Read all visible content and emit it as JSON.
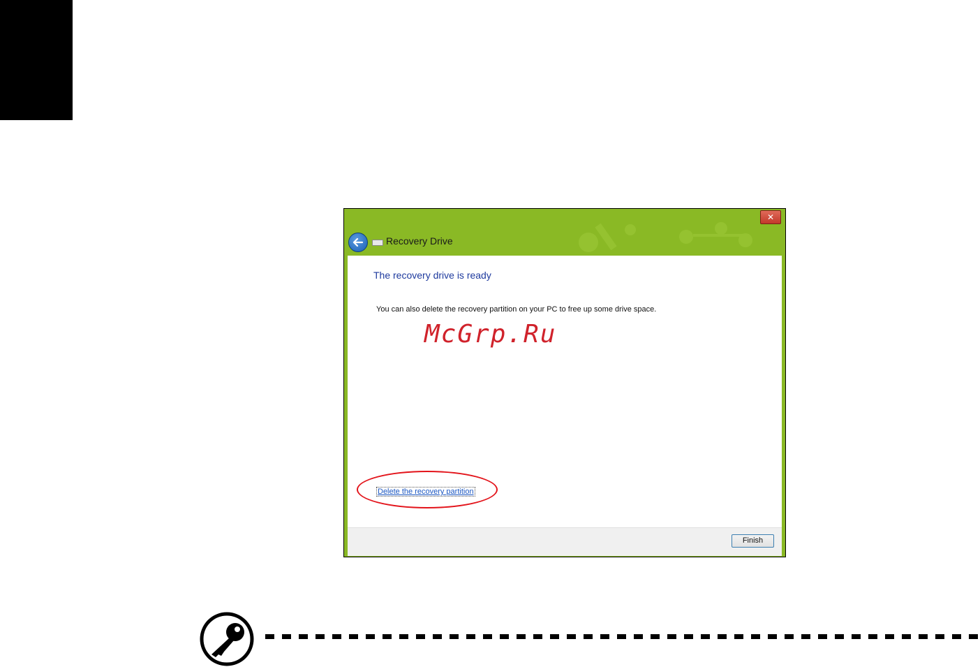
{
  "window": {
    "title": "Recovery Drive",
    "close_label": "✕",
    "heading": "The recovery drive is ready",
    "body_text": "You can also delete the recovery partition on your PC to free up some drive space.",
    "delete_link": "Delete the recovery partition",
    "finish_button": "Finish"
  },
  "watermark": "McGrp.Ru",
  "icons": {
    "back": "back-arrow-icon",
    "drive": "drive-icon",
    "close": "close-icon",
    "note": "key-icon"
  },
  "colors": {
    "window_frame": "#8ab925",
    "heading": "#1e3a9e",
    "link": "#1a56c2",
    "highlight": "#e3141b",
    "close": "#c2392a"
  }
}
